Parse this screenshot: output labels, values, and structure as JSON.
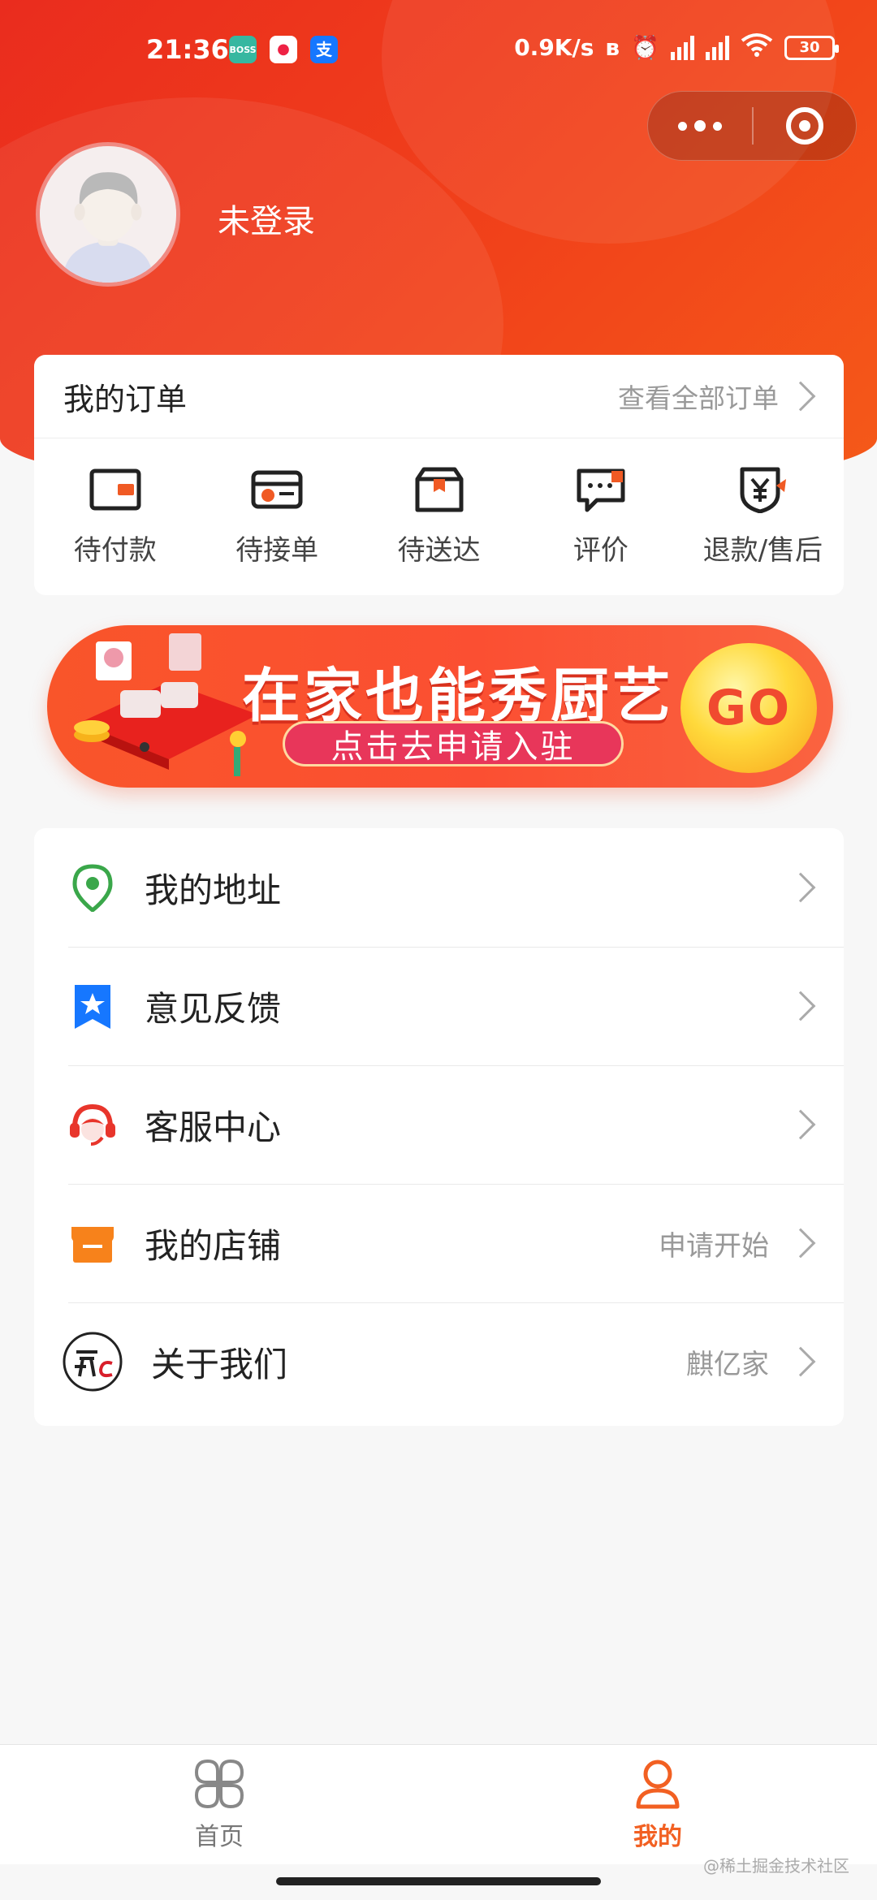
{
  "status_bar": {
    "time": "21:36",
    "network_speed": "0.9K/s",
    "battery": "30",
    "app_badges": {
      "boss": "BOSS 直聘",
      "alipay": "支"
    }
  },
  "capsule": {
    "more_icon": "more-dots-icon",
    "close_icon": "target-close-icon"
  },
  "profile": {
    "name": "未登录"
  },
  "orders": {
    "title": "我的订单",
    "view_all": "查看全部订单",
    "items": [
      {
        "label": "待付款",
        "icon": "wallet-icon"
      },
      {
        "label": "待接单",
        "icon": "card-icon"
      },
      {
        "label": "待送达",
        "icon": "package-icon"
      },
      {
        "label": "评价",
        "icon": "comment-icon"
      },
      {
        "label": "退款/售后",
        "icon": "refund-icon"
      }
    ]
  },
  "banner": {
    "title": "在家也能秀厨艺",
    "cta": "点击去申请入驻",
    "go": "GO"
  },
  "menu": [
    {
      "label": "我的地址",
      "value": "",
      "icon": "location-pin-icon",
      "color": "#3aa74a"
    },
    {
      "label": "意见反馈",
      "value": "",
      "icon": "star-bookmark-icon",
      "color": "#1677ff"
    },
    {
      "label": "客服中心",
      "value": "",
      "icon": "customer-service-icon",
      "color": "#e8352b"
    },
    {
      "label": "我的店铺",
      "value": "申请开始",
      "icon": "shop-icon",
      "color": "#f7821b"
    },
    {
      "label": "关于我们",
      "value": "麒亿家",
      "icon": "brand-logo-icon",
      "color": "#222222"
    }
  ],
  "tabbar": {
    "home": "首页",
    "mine": "我的",
    "active_color": "#f26022"
  },
  "watermark": "@稀土掘金技术社区"
}
